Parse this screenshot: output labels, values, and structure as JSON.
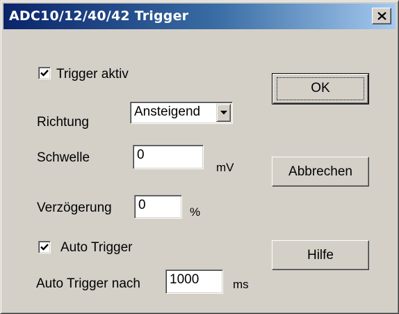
{
  "window": {
    "title": "ADC10/12/40/42 Trigger",
    "close_label": "Close"
  },
  "form": {
    "trigger_active": {
      "label": "Trigger aktiv",
      "checked": true
    },
    "direction": {
      "label": "Richtung",
      "value": "Ansteigend"
    },
    "threshold": {
      "label": "Schwelle",
      "value": "0",
      "unit": "mV"
    },
    "delay": {
      "label": "Verzögerung",
      "value": "0",
      "unit": "%"
    },
    "auto_trigger": {
      "label": "Auto Trigger",
      "checked": true
    },
    "auto_trigger_after": {
      "label": "Auto Trigger nach",
      "value": "1000",
      "unit": "ms"
    }
  },
  "buttons": {
    "ok": "OK",
    "cancel": "Abbrechen",
    "help": "Hilfe"
  },
  "colors": {
    "title_gradient_start": "#0a246a",
    "title_gradient_end": "#a6caf0",
    "dialog_face": "#d4d0c8"
  }
}
